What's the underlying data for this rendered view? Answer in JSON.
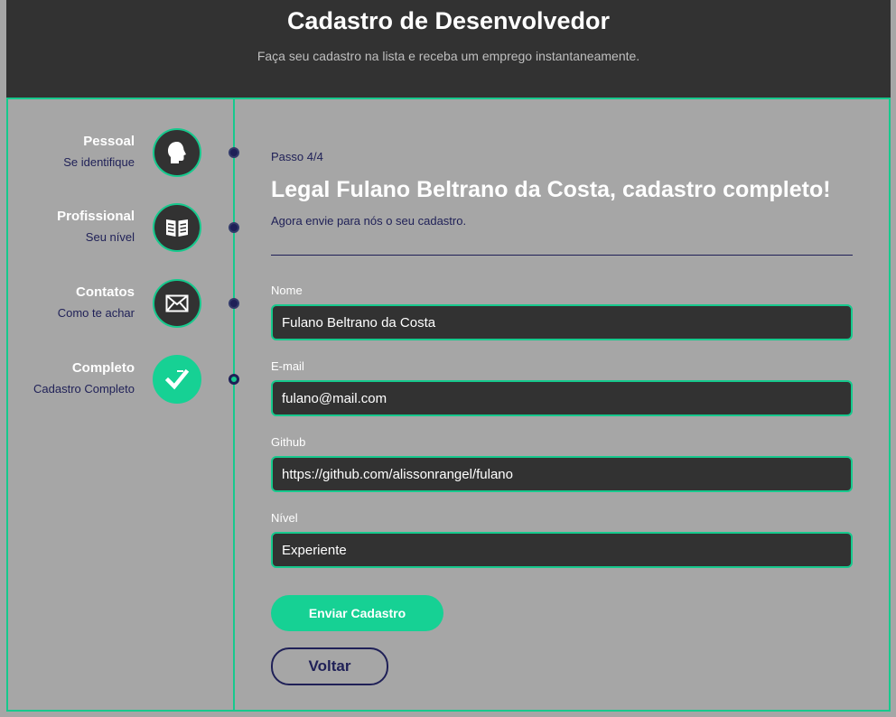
{
  "header": {
    "title": "Cadastro de Desenvolvedor",
    "subtitle": "Faça seu cadastro na lista e receba um emprego instantaneamente."
  },
  "steps": [
    {
      "title": "Pessoal",
      "subtitle": "Se identifique",
      "icon": "head-icon"
    },
    {
      "title": "Profissional",
      "subtitle": "Seu nível",
      "icon": "book-icon"
    },
    {
      "title": "Contatos",
      "subtitle": "Como te achar",
      "icon": "envelope-icon"
    },
    {
      "title": "Completo",
      "subtitle": "Cadastro Completo",
      "icon": "checkmark-icon"
    }
  ],
  "colors": {
    "accent": "#16c98d",
    "dark": "#323232",
    "navy": "#1f2057",
    "background": "#a6a6a6"
  },
  "main": {
    "step_counter": "Passo 4/4",
    "heading": "Legal Fulano Beltrano da Costa, cadastro completo!",
    "description": "Agora envie para nós o seu cadastro.",
    "fields": {
      "name": {
        "label": "Nome",
        "value": "Fulano Beltrano da Costa"
      },
      "email": {
        "label": "E-mail",
        "value": "fulano@mail.com"
      },
      "github": {
        "label": "Github",
        "value": "https://github.com/alissonrangel/fulano"
      },
      "level": {
        "label": "Nível",
        "value": "Experiente"
      }
    },
    "submit_label": "Enviar Cadastro",
    "back_label": "Voltar"
  }
}
